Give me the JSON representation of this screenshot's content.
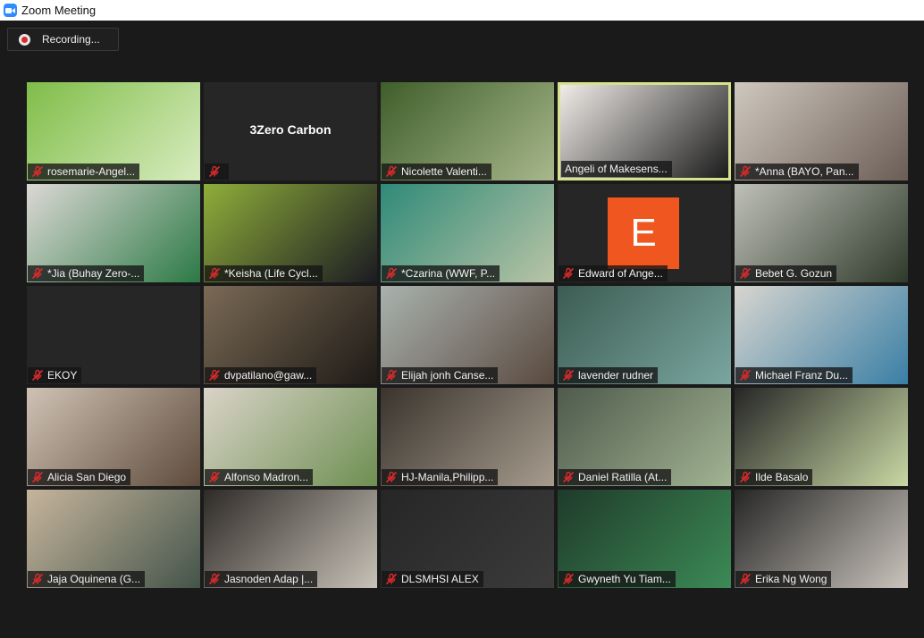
{
  "window": {
    "title": "Zoom Meeting"
  },
  "recording": {
    "label": "Recording..."
  },
  "participants": [
    {
      "name": "rosemarie-Angel...",
      "bg": "#7fbd48",
      "bg2": "#d8ecc0",
      "muted": true
    },
    {
      "name": "",
      "center_text": "3Zero Carbon",
      "bg": "#262626",
      "bg2": "#262626",
      "muted": true
    },
    {
      "name": "Nicolette Valenti...",
      "bg": "#3f5e2a",
      "bg2": "#a8b88c",
      "muted": true
    },
    {
      "name": "Angeli of Makesens...",
      "bg": "#f0ece8",
      "bg2": "#1c1c1c",
      "muted": false,
      "active": true
    },
    {
      "name": "*Anna (BAYO, Pan...",
      "bg": "#cfc8bf",
      "bg2": "#6b5d55",
      "muted": true
    },
    {
      "name": "*Jia (Buhay Zero-...",
      "bg": "#dcd8d4",
      "bg2": "#2c7a46",
      "muted": true
    },
    {
      "name": "*Keisha (Life Cycl...",
      "bg": "#8fae3a",
      "bg2": "#1b1b22",
      "muted": true
    },
    {
      "name": "*Czarina (WWF, P...",
      "bg": "#2f8a78",
      "bg2": "#b9c4a6",
      "muted": true
    },
    {
      "name": "Edward  of Ange...",
      "avatar_letter": "E",
      "bg": "#262626",
      "bg2": "#262626",
      "muted": true
    },
    {
      "name": "Bebet G. Gozun",
      "bg": "#bfc0b8",
      "bg2": "#2f3a2b",
      "muted": true
    },
    {
      "name": "EKOY",
      "bg": "#262626",
      "bg2": "#262626",
      "muted": true
    },
    {
      "name": "dvpatilano@gaw...",
      "bg": "#7a6a55",
      "bg2": "#1e1a16",
      "muted": true
    },
    {
      "name": "Elijah jonh Canse...",
      "bg": "#a9b2ae",
      "bg2": "#5a4a40",
      "muted": true
    },
    {
      "name": "lavender rudner",
      "bg": "#3c5c52",
      "bg2": "#7aa6a0",
      "muted": true
    },
    {
      "name": "Michael Franz Du...",
      "bg": "#d7d5cf",
      "bg2": "#3a7fa5",
      "muted": true
    },
    {
      "name": "Alicia San Diego",
      "bg": "#cfc2b4",
      "bg2": "#5e4b3c",
      "muted": true
    },
    {
      "name": "Alfonso Madron...",
      "bg": "#d9d3c7",
      "bg2": "#6e8f52",
      "muted": true
    },
    {
      "name": "HJ-Manila,Philipp...",
      "bg": "#3a342d",
      "bg2": "#a69c8e",
      "muted": true
    },
    {
      "name": "Daniel Ratilla (At...",
      "bg": "#4f5a4c",
      "bg2": "#a2b493",
      "muted": true
    },
    {
      "name": "Ilde Basalo",
      "bg": "#262626",
      "bg2": "#c9d8a4",
      "muted": true
    },
    {
      "name": "Jaja Oquinena (G...",
      "bg": "#c6b59c",
      "bg2": "#44544a",
      "muted": true
    },
    {
      "name": "Jasnoden Adap |...",
      "bg": "#2e2a26",
      "bg2": "#c8c2b8",
      "muted": true
    },
    {
      "name": "DLSMHSI ALEX",
      "bg": "#262626",
      "bg2": "#3b3b3b",
      "muted": true
    },
    {
      "name": "Gwyneth Yu Tiam...",
      "bg": "#1f3b2a",
      "bg2": "#3c8a56",
      "muted": true
    },
    {
      "name": "Erika Ng Wong",
      "bg": "#262626",
      "bg2": "#c9c3bb",
      "muted": true
    }
  ],
  "colors": {
    "active_border": "#d6e38a",
    "mute_red": "#d92b2b",
    "avatar_orange": "#f0561f"
  }
}
